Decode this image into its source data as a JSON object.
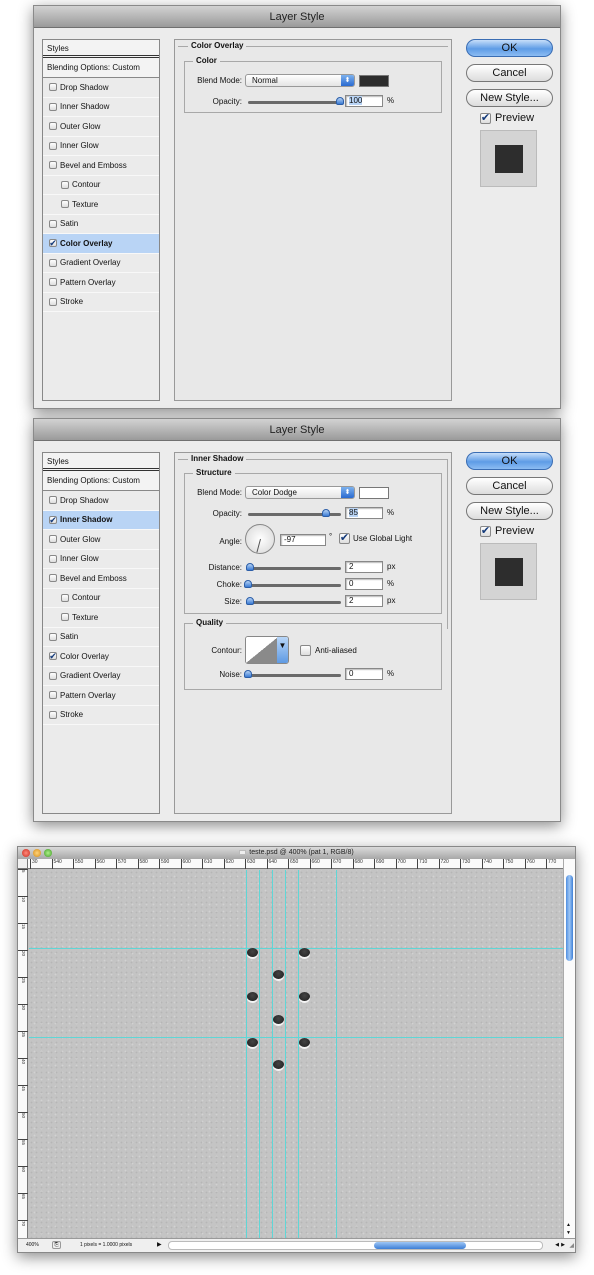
{
  "dialog1": {
    "title": "Layer Style",
    "styles_header": "Styles",
    "blending_options": "Blending Options: Custom",
    "style_items": [
      {
        "label": "Drop Shadow",
        "checked": false,
        "active": false,
        "sub": false
      },
      {
        "label": "Inner Shadow",
        "checked": false,
        "active": false,
        "sub": false
      },
      {
        "label": "Outer Glow",
        "checked": false,
        "active": false,
        "sub": false
      },
      {
        "label": "Inner Glow",
        "checked": false,
        "active": false,
        "sub": false
      },
      {
        "label": "Bevel and Emboss",
        "checked": false,
        "active": false,
        "sub": false
      },
      {
        "label": "Contour",
        "checked": false,
        "active": false,
        "sub": true
      },
      {
        "label": "Texture",
        "checked": false,
        "active": false,
        "sub": true
      },
      {
        "label": "Satin",
        "checked": false,
        "active": false,
        "sub": false
      },
      {
        "label": "Color Overlay",
        "checked": true,
        "active": true,
        "sub": false
      },
      {
        "label": "Gradient Overlay",
        "checked": false,
        "active": false,
        "sub": false
      },
      {
        "label": "Pattern Overlay",
        "checked": false,
        "active": false,
        "sub": false
      },
      {
        "label": "Stroke",
        "checked": false,
        "active": false,
        "sub": false
      }
    ],
    "section_title": "Color Overlay",
    "group_title": "Color",
    "blend_mode_label": "Blend Mode:",
    "blend_mode_value": "Normal",
    "overlay_color": "#2d2d2d",
    "opacity_label": "Opacity:",
    "opacity_value": "100",
    "opacity_fraction": 1.0,
    "opacity_unit": "%",
    "ok": "OK",
    "cancel": "Cancel",
    "new_style": "New Style...",
    "preview_label": "Preview",
    "preview_checked": true
  },
  "dialog2": {
    "title": "Layer Style",
    "styles_header": "Styles",
    "blending_options": "Blending Options: Custom",
    "style_items": [
      {
        "label": "Drop Shadow",
        "checked": false,
        "active": false,
        "sub": false
      },
      {
        "label": "Inner Shadow",
        "checked": true,
        "active": true,
        "sub": false
      },
      {
        "label": "Outer Glow",
        "checked": false,
        "active": false,
        "sub": false
      },
      {
        "label": "Inner Glow",
        "checked": false,
        "active": false,
        "sub": false
      },
      {
        "label": "Bevel and Emboss",
        "checked": false,
        "active": false,
        "sub": false
      },
      {
        "label": "Contour",
        "checked": false,
        "active": false,
        "sub": true
      },
      {
        "label": "Texture",
        "checked": false,
        "active": false,
        "sub": true
      },
      {
        "label": "Satin",
        "checked": false,
        "active": false,
        "sub": false
      },
      {
        "label": "Color Overlay",
        "checked": true,
        "active": false,
        "sub": false
      },
      {
        "label": "Gradient Overlay",
        "checked": false,
        "active": false,
        "sub": false
      },
      {
        "label": "Pattern Overlay",
        "checked": false,
        "active": false,
        "sub": false
      },
      {
        "label": "Stroke",
        "checked": false,
        "active": false,
        "sub": false
      }
    ],
    "section_title": "Inner Shadow",
    "structure_title": "Structure",
    "blend_mode_label": "Blend Mode:",
    "blend_mode_value": "Color Dodge",
    "shadow_color": "#ffffff",
    "opacity_label": "Opacity:",
    "opacity_value": "85",
    "opacity_fraction": 0.85,
    "percent": "%",
    "px": "px",
    "degree": "°",
    "angle_label": "Angle:",
    "angle_value": "-97",
    "global_light_label": "Use Global Light",
    "global_light_checked": true,
    "distance_label": "Distance:",
    "distance_value": "2",
    "choke_label": "Choke:",
    "choke_value": "0",
    "size_label": "Size:",
    "size_value": "2",
    "quality_title": "Quality",
    "contour_label": "Contour:",
    "anti_aliased_label": "Anti-aliased",
    "anti_aliased_checked": false,
    "noise_label": "Noise:",
    "noise_value": "0",
    "ok": "OK",
    "cancel": "Cancel",
    "new_style": "New Style...",
    "preview_label": "Preview",
    "preview_checked": true
  },
  "document": {
    "title": "teste.psd @ 400% (pat 1, RGB/8)",
    "ruler_top_ticks": [
      "30",
      "540",
      "550",
      "560",
      "570",
      "580",
      "590",
      "600",
      "610",
      "620",
      "630",
      "640",
      "650",
      "660",
      "670",
      "680",
      "690",
      "700",
      "710",
      "720",
      "730",
      "740",
      "750",
      "760",
      "770"
    ],
    "ruler_left_ticks": [
      "5",
      "10",
      "15",
      "20",
      "25",
      "30",
      "35",
      "40",
      "45",
      "50",
      "55",
      "60",
      "65",
      "70"
    ],
    "zoom_level": "400%",
    "status_info": "1 pixels = 1.0000 pixels"
  }
}
